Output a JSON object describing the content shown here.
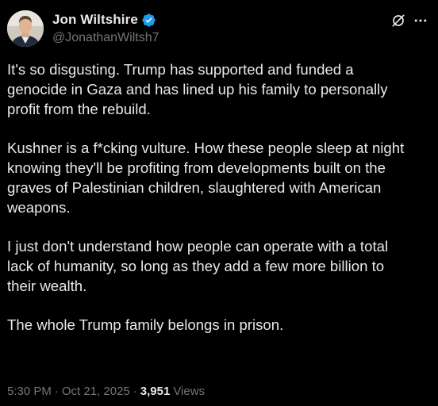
{
  "author": {
    "display_name": "Jon Wiltshire",
    "handle": "@JonathanWiltsh7",
    "verified": true
  },
  "post": {
    "paragraphs": [
      "It's so disgusting. Trump has supported and funded a\ngenocide in Gaza and has lined up his family to personally\nprofit from the rebuild.",
      "Kushner is a f*cking vulture. How these people sleep at night\nknowing they'll be profiting from developments built on the\ngraves of Palestinian children, slaughtered with American\nweapons.",
      "I just don't understand how people can operate with a total\nlack of humanity, so long as they add a few more billion to\ntheir wealth.",
      "The whole Trump family belongs in prison."
    ],
    "time": "5:30 PM",
    "date": "Oct 21, 2025",
    "separator": "·",
    "views_count": "3,951",
    "views_label": "Views"
  },
  "icons": {
    "verified": "verified-badge-icon",
    "grok": "grok-icon",
    "more": "more-options-icon"
  },
  "colors": {
    "background": "#000000",
    "text_primary": "#e7e9ea",
    "text_secondary": "#71767b",
    "verified_blue": "#1d9bf0"
  }
}
